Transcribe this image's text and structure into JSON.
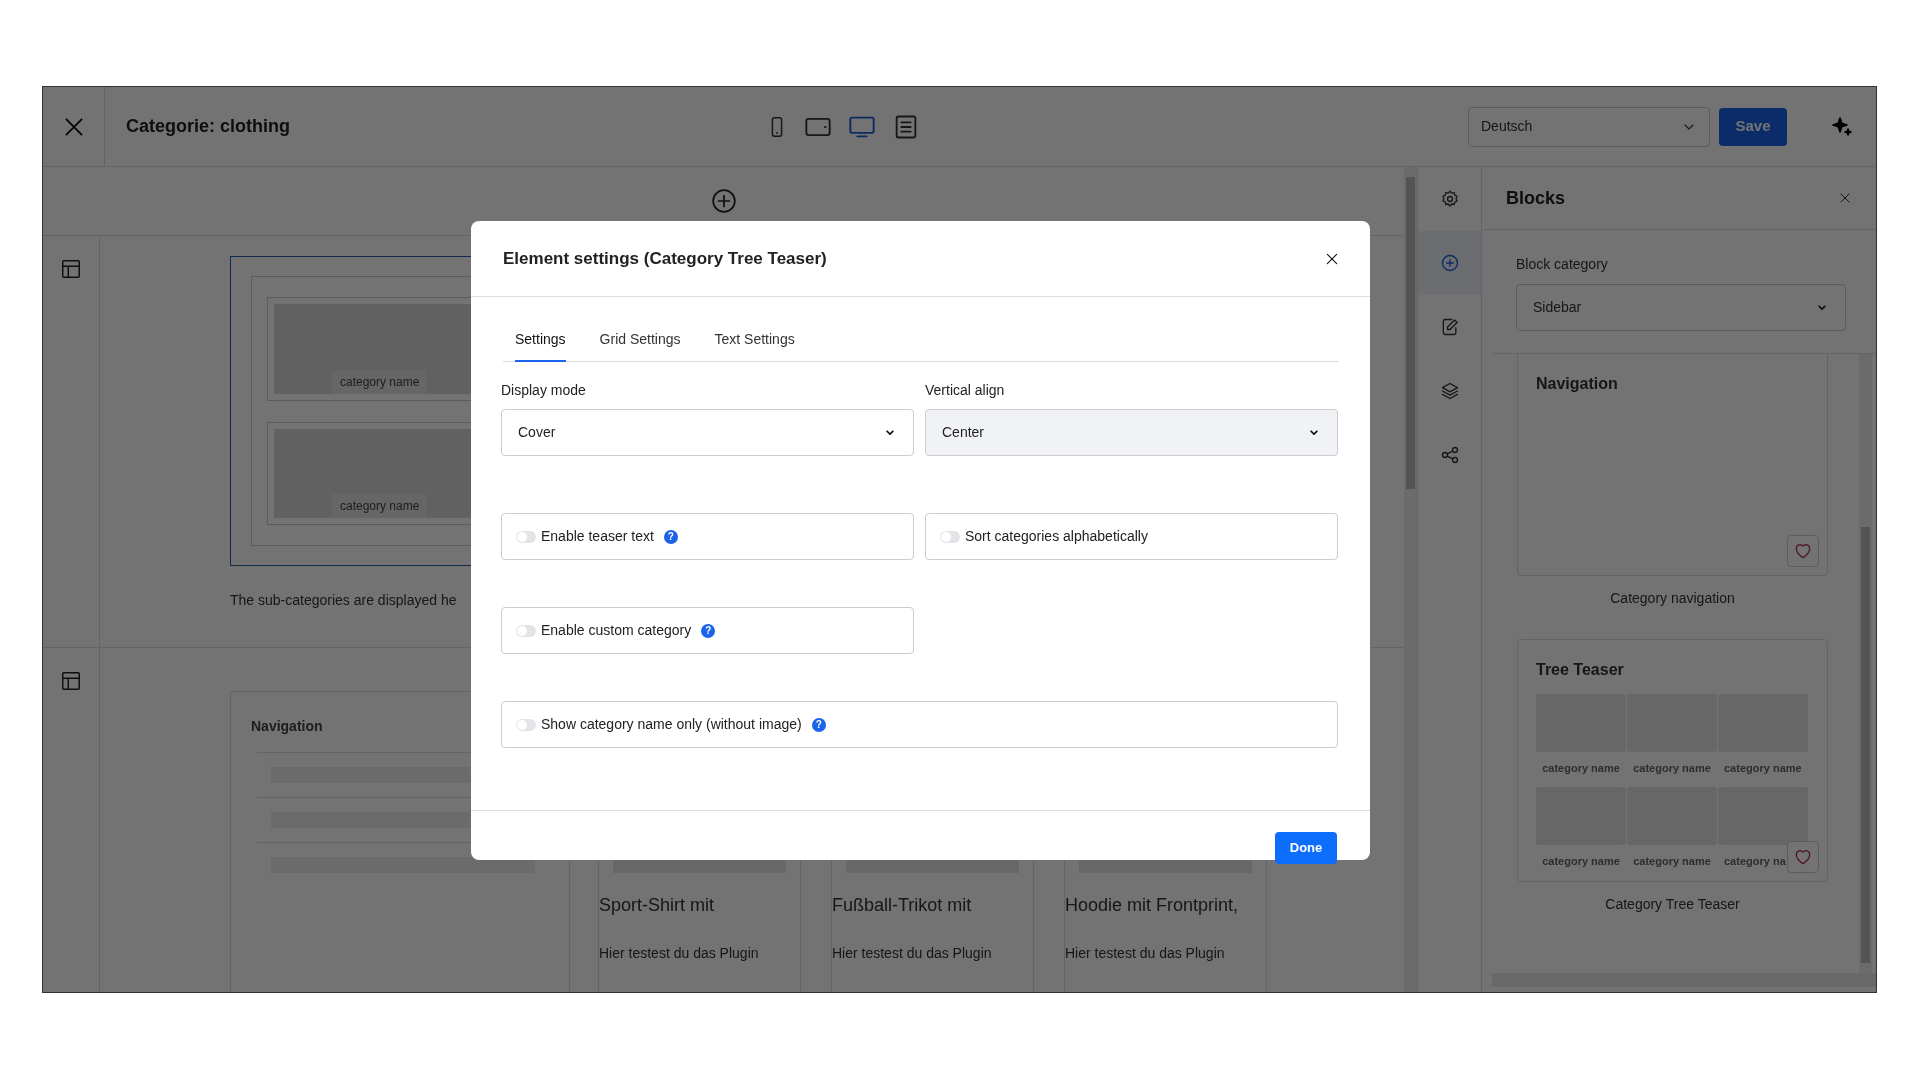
{
  "topbar": {
    "title": "Categorie: clothing",
    "devices": [
      {
        "kind": "mobile",
        "selected": false
      },
      {
        "kind": "tablet",
        "selected": false
      },
      {
        "kind": "desktop",
        "selected": true
      },
      {
        "kind": "list",
        "selected": false
      }
    ],
    "language": "Deutsch",
    "save": "Save"
  },
  "canvas": {
    "sections": [
      {
        "kind": "tree-teaser",
        "selected": true,
        "category_names": [
          "category name",
          "category name"
        ],
        "note": "The sub-categories are displayed he"
      },
      {
        "kind": "listing",
        "navigation_title": "Navigation",
        "products": [
          {
            "title": "Sport-Shirt mit",
            "text": "Hier testest du das Plugin"
          },
          {
            "title": "Fußball-Trikot mit",
            "text": "Hier testest du das Plugin"
          },
          {
            "title": "Hoodie mit Frontprint,",
            "text": "Hier testest du das Plugin"
          }
        ]
      }
    ]
  },
  "rail": [
    {
      "kind": "settings",
      "selected": false
    },
    {
      "kind": "add",
      "selected": true
    },
    {
      "kind": "edit",
      "selected": false
    },
    {
      "kind": "layers",
      "selected": false
    },
    {
      "kind": "share",
      "selected": false
    }
  ],
  "blocks_panel": {
    "title": "Blocks",
    "category_label": "Block category",
    "category": "Sidebar",
    "blocks": [
      {
        "kind": "navigation",
        "title": "Navigation",
        "caption": "Category navigation",
        "favorite": false
      },
      {
        "kind": "tree-teaser",
        "title": "Tree Teaser",
        "category_names": [
          "category name",
          "category name",
          "category name",
          "category name",
          "category name",
          "category na"
        ],
        "caption": "Category Tree Teaser",
        "favorite": false
      }
    ]
  },
  "modal": {
    "title": "Element settings (Category Tree Teaser)",
    "tabs": [
      {
        "label": "Settings",
        "selected": true
      },
      {
        "label": "Grid Settings",
        "selected": false
      },
      {
        "label": "Text Settings",
        "selected": false
      }
    ],
    "selects": [
      {
        "label": "Display mode",
        "value": "Cover",
        "disabled": false
      },
      {
        "label": "Vertical align",
        "value": "Center",
        "disabled": true
      }
    ],
    "toggles": [
      {
        "kind": "half",
        "label": "Enable teaser text",
        "on": false,
        "help": "?"
      },
      {
        "kind": "half",
        "label": "Sort categories alphabetically",
        "on": false
      },
      {
        "kind": "half",
        "label": "Enable custom category",
        "on": false,
        "help": "?"
      },
      {
        "kind": "full",
        "label": "Show category name only (without image)",
        "on": false,
        "help": "?"
      }
    ],
    "done": "Done"
  }
}
